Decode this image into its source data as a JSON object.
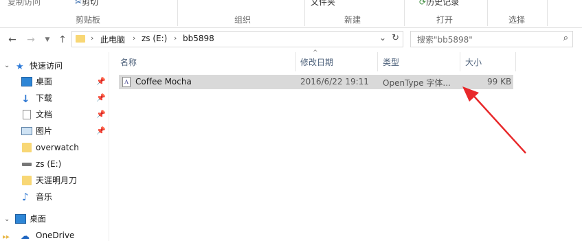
{
  "ribbon": {
    "top_left": "复制访问",
    "cut": "剪切",
    "new_folder": "文件夹",
    "history": "历史记录",
    "groups": [
      "剪贴板",
      "组织",
      "新建",
      "打开",
      "选择"
    ]
  },
  "navigation": {
    "path": [
      "此电脑",
      "zs (E:)",
      "bb5898"
    ],
    "search_placeholder": "搜索\"bb5898\""
  },
  "sidebar": {
    "items": [
      {
        "label": "快速访问",
        "icon": "star-icon"
      },
      {
        "label": "桌面",
        "icon": "desktop-icon",
        "pinned": true
      },
      {
        "label": "下载",
        "icon": "download-icon",
        "pinned": true
      },
      {
        "label": "文档",
        "icon": "document-icon",
        "pinned": true
      },
      {
        "label": "图片",
        "icon": "picture-icon",
        "pinned": true
      },
      {
        "label": "overwatch",
        "icon": "folder-icon"
      },
      {
        "label": "zs (E:)",
        "icon": "drive-icon"
      },
      {
        "label": "天涯明月刀",
        "icon": "folder-icon"
      },
      {
        "label": "音乐",
        "icon": "music-icon"
      },
      {
        "label": "桌面",
        "icon": "desktop-icon"
      },
      {
        "label": "OneDrive",
        "icon": "cloud-icon"
      }
    ]
  },
  "columns": [
    "名称",
    "修改日期",
    "类型",
    "大小"
  ],
  "files": [
    {
      "name": "Coffee Mocha",
      "modified": "2016/6/22 19:11",
      "type": "OpenType 字体...",
      "size": "99 KB",
      "icon": "font-file-icon"
    }
  ],
  "annotation": {
    "color": "#e8282a",
    "icon": "red-arrow"
  }
}
